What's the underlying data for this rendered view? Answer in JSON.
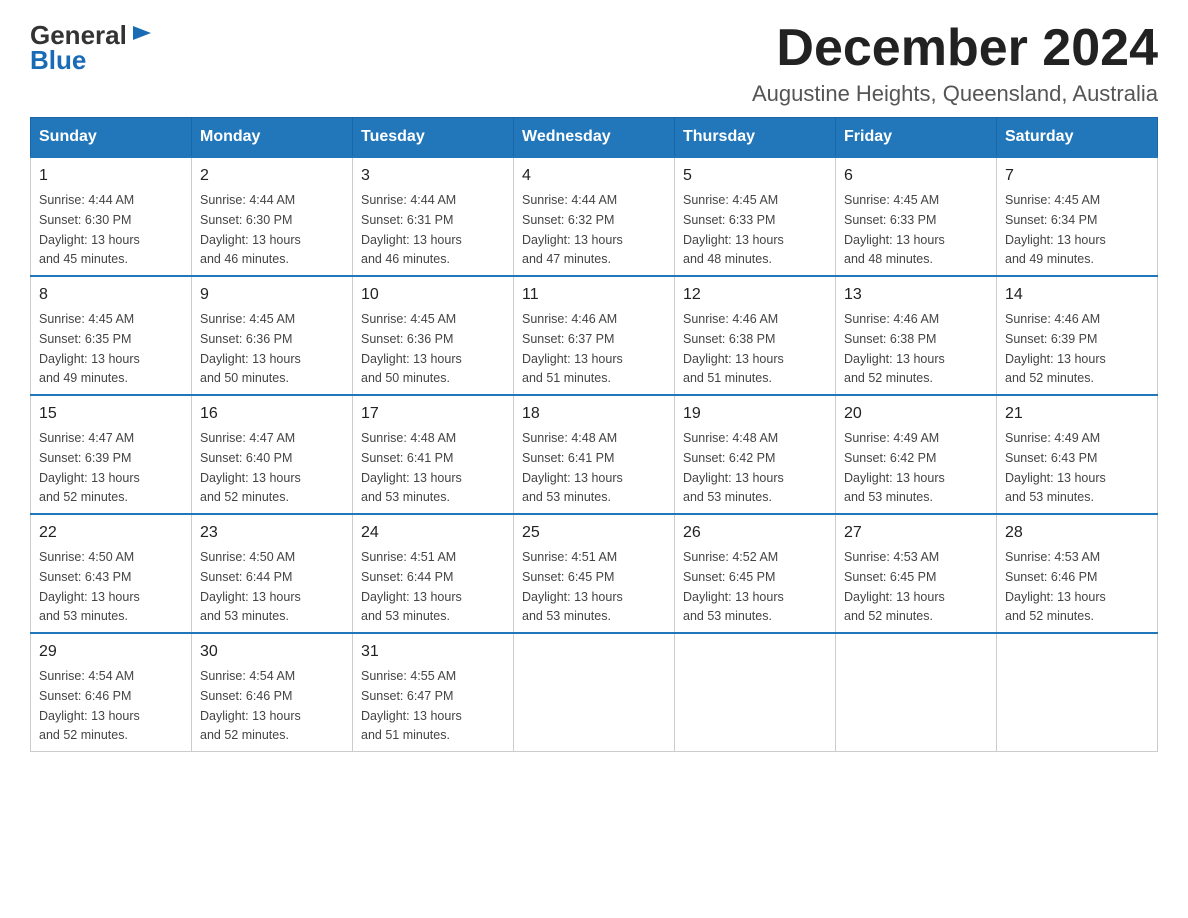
{
  "logo": {
    "line1": "General",
    "line2": "Blue"
  },
  "title": "December 2024",
  "subtitle": "Augustine Heights, Queensland, Australia",
  "days_of_week": [
    "Sunday",
    "Monday",
    "Tuesday",
    "Wednesday",
    "Thursday",
    "Friday",
    "Saturday"
  ],
  "weeks": [
    [
      {
        "day": "1",
        "sunrise": "4:44 AM",
        "sunset": "6:30 PM",
        "daylight": "13 hours and 45 minutes."
      },
      {
        "day": "2",
        "sunrise": "4:44 AM",
        "sunset": "6:30 PM",
        "daylight": "13 hours and 46 minutes."
      },
      {
        "day": "3",
        "sunrise": "4:44 AM",
        "sunset": "6:31 PM",
        "daylight": "13 hours and 46 minutes."
      },
      {
        "day": "4",
        "sunrise": "4:44 AM",
        "sunset": "6:32 PM",
        "daylight": "13 hours and 47 minutes."
      },
      {
        "day": "5",
        "sunrise": "4:45 AM",
        "sunset": "6:33 PM",
        "daylight": "13 hours and 48 minutes."
      },
      {
        "day": "6",
        "sunrise": "4:45 AM",
        "sunset": "6:33 PM",
        "daylight": "13 hours and 48 minutes."
      },
      {
        "day": "7",
        "sunrise": "4:45 AM",
        "sunset": "6:34 PM",
        "daylight": "13 hours and 49 minutes."
      }
    ],
    [
      {
        "day": "8",
        "sunrise": "4:45 AM",
        "sunset": "6:35 PM",
        "daylight": "13 hours and 49 minutes."
      },
      {
        "day": "9",
        "sunrise": "4:45 AM",
        "sunset": "6:36 PM",
        "daylight": "13 hours and 50 minutes."
      },
      {
        "day": "10",
        "sunrise": "4:45 AM",
        "sunset": "6:36 PM",
        "daylight": "13 hours and 50 minutes."
      },
      {
        "day": "11",
        "sunrise": "4:46 AM",
        "sunset": "6:37 PM",
        "daylight": "13 hours and 51 minutes."
      },
      {
        "day": "12",
        "sunrise": "4:46 AM",
        "sunset": "6:38 PM",
        "daylight": "13 hours and 51 minutes."
      },
      {
        "day": "13",
        "sunrise": "4:46 AM",
        "sunset": "6:38 PM",
        "daylight": "13 hours and 52 minutes."
      },
      {
        "day": "14",
        "sunrise": "4:46 AM",
        "sunset": "6:39 PM",
        "daylight": "13 hours and 52 minutes."
      }
    ],
    [
      {
        "day": "15",
        "sunrise": "4:47 AM",
        "sunset": "6:39 PM",
        "daylight": "13 hours and 52 minutes."
      },
      {
        "day": "16",
        "sunrise": "4:47 AM",
        "sunset": "6:40 PM",
        "daylight": "13 hours and 52 minutes."
      },
      {
        "day": "17",
        "sunrise": "4:48 AM",
        "sunset": "6:41 PM",
        "daylight": "13 hours and 53 minutes."
      },
      {
        "day": "18",
        "sunrise": "4:48 AM",
        "sunset": "6:41 PM",
        "daylight": "13 hours and 53 minutes."
      },
      {
        "day": "19",
        "sunrise": "4:48 AM",
        "sunset": "6:42 PM",
        "daylight": "13 hours and 53 minutes."
      },
      {
        "day": "20",
        "sunrise": "4:49 AM",
        "sunset": "6:42 PM",
        "daylight": "13 hours and 53 minutes."
      },
      {
        "day": "21",
        "sunrise": "4:49 AM",
        "sunset": "6:43 PM",
        "daylight": "13 hours and 53 minutes."
      }
    ],
    [
      {
        "day": "22",
        "sunrise": "4:50 AM",
        "sunset": "6:43 PM",
        "daylight": "13 hours and 53 minutes."
      },
      {
        "day": "23",
        "sunrise": "4:50 AM",
        "sunset": "6:44 PM",
        "daylight": "13 hours and 53 minutes."
      },
      {
        "day": "24",
        "sunrise": "4:51 AM",
        "sunset": "6:44 PM",
        "daylight": "13 hours and 53 minutes."
      },
      {
        "day": "25",
        "sunrise": "4:51 AM",
        "sunset": "6:45 PM",
        "daylight": "13 hours and 53 minutes."
      },
      {
        "day": "26",
        "sunrise": "4:52 AM",
        "sunset": "6:45 PM",
        "daylight": "13 hours and 53 minutes."
      },
      {
        "day": "27",
        "sunrise": "4:53 AM",
        "sunset": "6:45 PM",
        "daylight": "13 hours and 52 minutes."
      },
      {
        "day": "28",
        "sunrise": "4:53 AM",
        "sunset": "6:46 PM",
        "daylight": "13 hours and 52 minutes."
      }
    ],
    [
      {
        "day": "29",
        "sunrise": "4:54 AM",
        "sunset": "6:46 PM",
        "daylight": "13 hours and 52 minutes."
      },
      {
        "day": "30",
        "sunrise": "4:54 AM",
        "sunset": "6:46 PM",
        "daylight": "13 hours and 52 minutes."
      },
      {
        "day": "31",
        "sunrise": "4:55 AM",
        "sunset": "6:47 PM",
        "daylight": "13 hours and 51 minutes."
      },
      null,
      null,
      null,
      null
    ]
  ],
  "labels": {
    "sunrise": "Sunrise:",
    "sunset": "Sunset:",
    "daylight": "Daylight:"
  }
}
